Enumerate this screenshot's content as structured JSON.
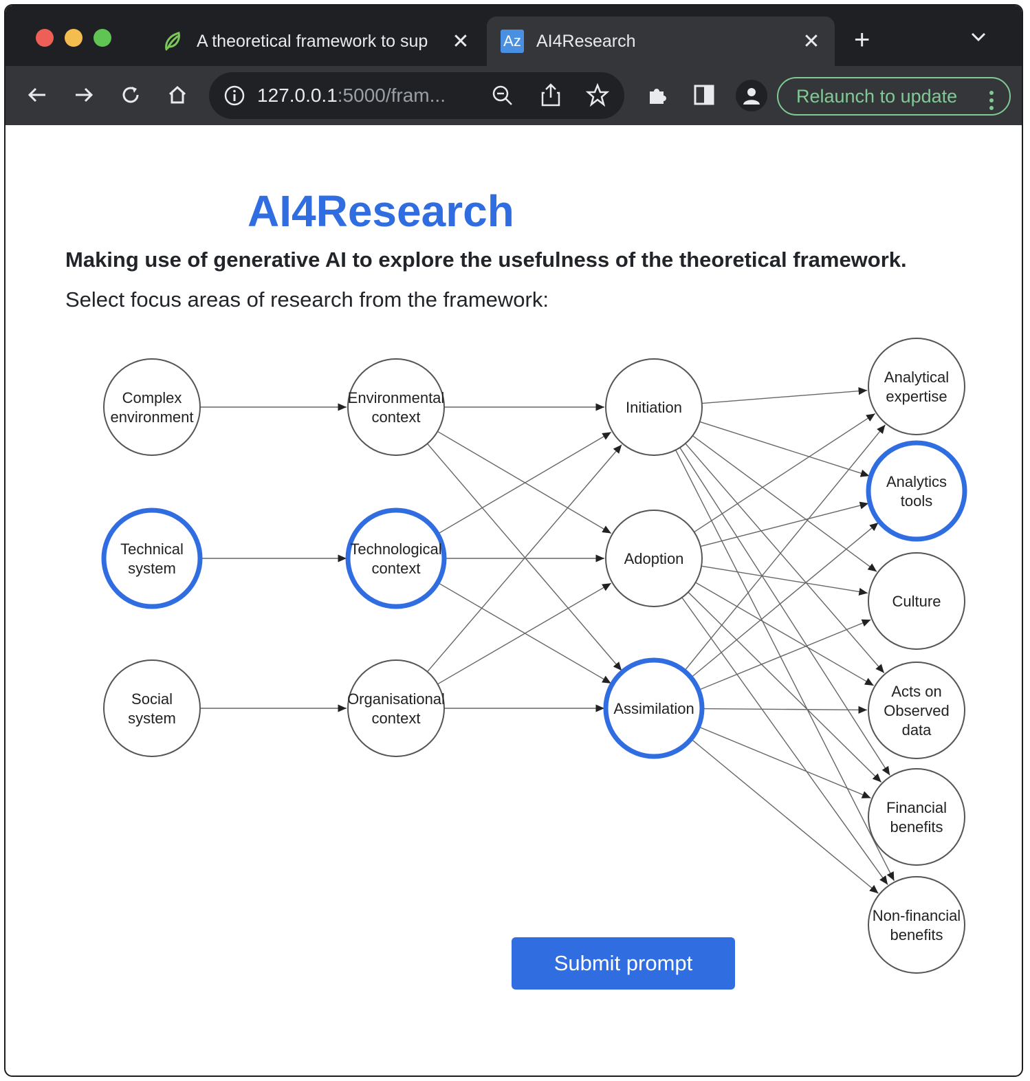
{
  "browser": {
    "tabs": [
      {
        "title": "A theoretical framework to sup",
        "favicon": "leaf-icon",
        "active": false
      },
      {
        "title": "AI4Research",
        "favicon": "Az",
        "active": true
      }
    ],
    "address": {
      "host": "127.0.0.1",
      "rest": ":5000/fram..."
    },
    "relaunch_label": "Relaunch to update"
  },
  "page": {
    "title": "AI4Research",
    "subtitle": "Making use of generative AI to explore the usefulness of the theoretical framework.",
    "instruction": "Select focus areas of research from the framework:",
    "submit_label": "Submit prompt"
  },
  "diagram": {
    "nodes": [
      {
        "id": "complex",
        "lines": [
          "Complex",
          "environment"
        ],
        "selected": false
      },
      {
        "id": "technical",
        "lines": [
          "Technical",
          "system"
        ],
        "selected": true
      },
      {
        "id": "social",
        "lines": [
          "Social",
          "system"
        ],
        "selected": false
      },
      {
        "id": "environmental",
        "lines": [
          "Environmental",
          "context"
        ],
        "selected": false
      },
      {
        "id": "technological",
        "lines": [
          "Technological",
          "context"
        ],
        "selected": true
      },
      {
        "id": "organisational",
        "lines": [
          "Organisational",
          "context"
        ],
        "selected": false
      },
      {
        "id": "initiation",
        "lines": [
          "Initiation"
        ],
        "selected": false
      },
      {
        "id": "adoption",
        "lines": [
          "Adoption"
        ],
        "selected": false
      },
      {
        "id": "assimilation",
        "lines": [
          "Assimilation"
        ],
        "selected": true
      },
      {
        "id": "analytical",
        "lines": [
          "Analytical",
          "expertise"
        ],
        "selected": false
      },
      {
        "id": "tools",
        "lines": [
          "Analytics",
          "tools"
        ],
        "selected": true
      },
      {
        "id": "culture",
        "lines": [
          "Culture"
        ],
        "selected": false
      },
      {
        "id": "acts",
        "lines": [
          "Acts on",
          "Observed",
          "data"
        ],
        "selected": false
      },
      {
        "id": "financial",
        "lines": [
          "Financial",
          "benefits"
        ],
        "selected": false
      },
      {
        "id": "nonfinancial",
        "lines": [
          "Non-financial",
          "benefits"
        ],
        "selected": false
      }
    ]
  }
}
